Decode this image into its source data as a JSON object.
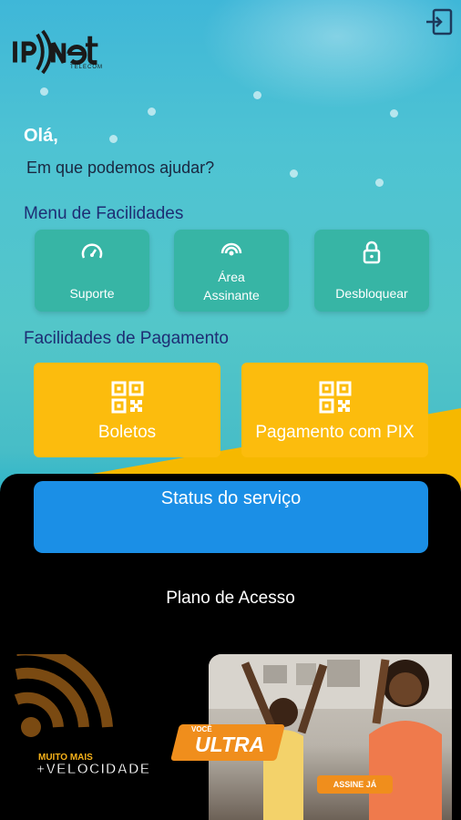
{
  "app": {
    "logo_text": "IPNet",
    "logo_subtext": "TELECOM"
  },
  "header": {
    "exit_icon": "logout-icon"
  },
  "greeting": "Olá,",
  "help_text": "Em que podemos ajudar?",
  "facilities": {
    "title": "Menu de Facilidades",
    "items": [
      {
        "label": "Suporte",
        "icon": "speedometer-icon"
      },
      {
        "label": "Área\nAssinante",
        "icon": "signal-icon"
      },
      {
        "label": "Desbloquear",
        "icon": "unlock-icon"
      }
    ]
  },
  "payment": {
    "title": "Facilidades de Pagamento",
    "items": [
      {
        "label": "Boletos",
        "icon": "qr-code-icon"
      },
      {
        "label": "Pagamento com PIX",
        "icon": "qr-code-icon"
      }
    ]
  },
  "status_button": "Status do serviço",
  "plano_title": "Plano de Acesso",
  "banner": {
    "muito_mais": "MUITO MAIS",
    "velocidade": "+VELOCIDADE",
    "voce": "VOCÊ",
    "ultra": "ULTRA",
    "assine": "ASSINE JÁ"
  },
  "colors": {
    "teal": "#37b5a5",
    "yellow": "#fcbc0d",
    "blue": "#1b8fe6",
    "navy": "#1e2e74",
    "orange": "#f08e1c"
  }
}
